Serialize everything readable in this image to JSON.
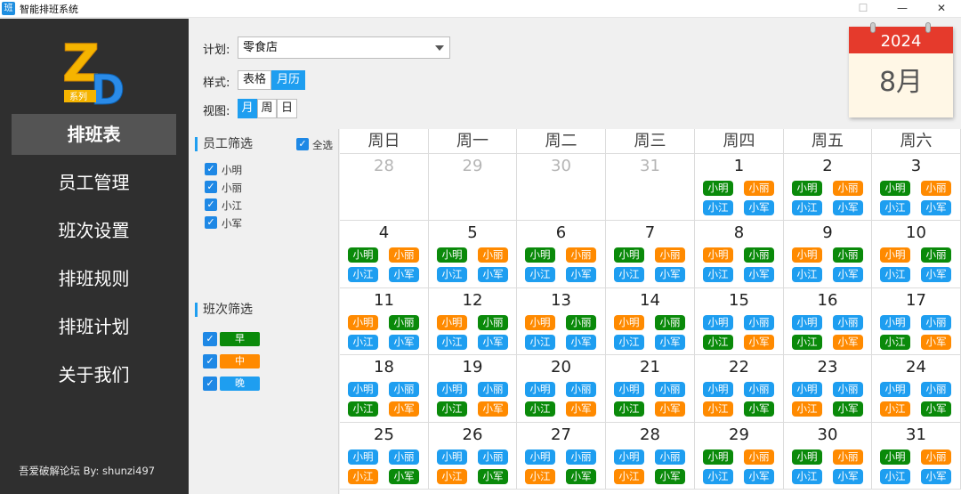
{
  "window": {
    "title": "智能排班系统",
    "icon_text": "班",
    "min": "—",
    "max": "☐",
    "close": "✕"
  },
  "sidebar": {
    "logo_text": "ZD",
    "logo_sub": "系列",
    "items": [
      {
        "label": "排班表",
        "active": true
      },
      {
        "label": "员工管理"
      },
      {
        "label": "班次设置"
      },
      {
        "label": "排班规则"
      },
      {
        "label": "排班计划"
      },
      {
        "label": "关于我们"
      }
    ],
    "footer": "吾爱破解论坛 By: shunzi497"
  },
  "controls": {
    "plan_label": "计划:",
    "plan_value": "零食店",
    "style_label": "样式:",
    "style_options": [
      "表格",
      "月历"
    ],
    "style_selected": "月历",
    "view_label": "视图:",
    "view_options": [
      "月",
      "周",
      "日"
    ],
    "view_selected": "月"
  },
  "badge": {
    "year": "2024",
    "month": "8月"
  },
  "filters": {
    "employee_title": "员工筛选",
    "select_all": "全选",
    "employees": [
      "小明",
      "小丽",
      "小江",
      "小军"
    ],
    "shift_title": "班次筛选",
    "shifts": [
      {
        "label": "早",
        "color": "#0a8a0a"
      },
      {
        "label": "中",
        "color": "#ff8a00"
      },
      {
        "label": "晚",
        "color": "#1e9ef0"
      }
    ]
  },
  "calendar": {
    "weekdays": [
      "周日",
      "周一",
      "周二",
      "周三",
      "周四",
      "周五",
      "周六"
    ],
    "colors": {
      "g": "#0a8a0a",
      "o": "#ff8a00",
      "b": "#1e9ef0"
    },
    "weeks": [
      [
        {
          "day": "28",
          "prev": true,
          "chips": []
        },
        {
          "day": "29",
          "prev": true,
          "chips": []
        },
        {
          "day": "30",
          "prev": true,
          "chips": []
        },
        {
          "day": "31",
          "prev": true,
          "chips": []
        },
        {
          "day": "1",
          "chips": [
            [
              "小明",
              "g"
            ],
            [
              "小丽",
              "o"
            ],
            [
              "小江",
              "b"
            ],
            [
              "小军",
              "b"
            ]
          ]
        },
        {
          "day": "2",
          "chips": [
            [
              "小明",
              "g"
            ],
            [
              "小丽",
              "o"
            ],
            [
              "小江",
              "b"
            ],
            [
              "小军",
              "b"
            ]
          ]
        },
        {
          "day": "3",
          "chips": [
            [
              "小明",
              "g"
            ],
            [
              "小丽",
              "o"
            ],
            [
              "小江",
              "b"
            ],
            [
              "小军",
              "b"
            ]
          ]
        }
      ],
      [
        {
          "day": "4",
          "chips": [
            [
              "小明",
              "g"
            ],
            [
              "小丽",
              "o"
            ],
            [
              "小江",
              "b"
            ],
            [
              "小军",
              "b"
            ]
          ]
        },
        {
          "day": "5",
          "chips": [
            [
              "小明",
              "g"
            ],
            [
              "小丽",
              "o"
            ],
            [
              "小江",
              "b"
            ],
            [
              "小军",
              "b"
            ]
          ]
        },
        {
          "day": "6",
          "chips": [
            [
              "小明",
              "g"
            ],
            [
              "小丽",
              "o"
            ],
            [
              "小江",
              "b"
            ],
            [
              "小军",
              "b"
            ]
          ]
        },
        {
          "day": "7",
          "chips": [
            [
              "小明",
              "g"
            ],
            [
              "小丽",
              "o"
            ],
            [
              "小江",
              "b"
            ],
            [
              "小军",
              "b"
            ]
          ]
        },
        {
          "day": "8",
          "chips": [
            [
              "小明",
              "o"
            ],
            [
              "小丽",
              "g"
            ],
            [
              "小江",
              "b"
            ],
            [
              "小军",
              "b"
            ]
          ]
        },
        {
          "day": "9",
          "chips": [
            [
              "小明",
              "o"
            ],
            [
              "小丽",
              "g"
            ],
            [
              "小江",
              "b"
            ],
            [
              "小军",
              "b"
            ]
          ]
        },
        {
          "day": "10",
          "chips": [
            [
              "小明",
              "o"
            ],
            [
              "小丽",
              "g"
            ],
            [
              "小江",
              "b"
            ],
            [
              "小军",
              "b"
            ]
          ]
        }
      ],
      [
        {
          "day": "11",
          "chips": [
            [
              "小明",
              "o"
            ],
            [
              "小丽",
              "g"
            ],
            [
              "小江",
              "b"
            ],
            [
              "小军",
              "b"
            ]
          ]
        },
        {
          "day": "12",
          "chips": [
            [
              "小明",
              "o"
            ],
            [
              "小丽",
              "g"
            ],
            [
              "小江",
              "b"
            ],
            [
              "小军",
              "b"
            ]
          ]
        },
        {
          "day": "13",
          "chips": [
            [
              "小明",
              "o"
            ],
            [
              "小丽",
              "g"
            ],
            [
              "小江",
              "b"
            ],
            [
              "小军",
              "b"
            ]
          ]
        },
        {
          "day": "14",
          "chips": [
            [
              "小明",
              "o"
            ],
            [
              "小丽",
              "g"
            ],
            [
              "小江",
              "b"
            ],
            [
              "小军",
              "b"
            ]
          ]
        },
        {
          "day": "15",
          "chips": [
            [
              "小明",
              "b"
            ],
            [
              "小丽",
              "b"
            ],
            [
              "小江",
              "g"
            ],
            [
              "小军",
              "o"
            ]
          ]
        },
        {
          "day": "16",
          "chips": [
            [
              "小明",
              "b"
            ],
            [
              "小丽",
              "b"
            ],
            [
              "小江",
              "g"
            ],
            [
              "小军",
              "o"
            ]
          ]
        },
        {
          "day": "17",
          "chips": [
            [
              "小明",
              "b"
            ],
            [
              "小丽",
              "b"
            ],
            [
              "小江",
              "g"
            ],
            [
              "小军",
              "o"
            ]
          ]
        }
      ],
      [
        {
          "day": "18",
          "chips": [
            [
              "小明",
              "b"
            ],
            [
              "小丽",
              "b"
            ],
            [
              "小江",
              "g"
            ],
            [
              "小军",
              "o"
            ]
          ]
        },
        {
          "day": "19",
          "chips": [
            [
              "小明",
              "b"
            ],
            [
              "小丽",
              "b"
            ],
            [
              "小江",
              "g"
            ],
            [
              "小军",
              "o"
            ]
          ]
        },
        {
          "day": "20",
          "chips": [
            [
              "小明",
              "b"
            ],
            [
              "小丽",
              "b"
            ],
            [
              "小江",
              "g"
            ],
            [
              "小军",
              "o"
            ]
          ]
        },
        {
          "day": "21",
          "chips": [
            [
              "小明",
              "b"
            ],
            [
              "小丽",
              "b"
            ],
            [
              "小江",
              "g"
            ],
            [
              "小军",
              "o"
            ]
          ]
        },
        {
          "day": "22",
          "chips": [
            [
              "小明",
              "b"
            ],
            [
              "小丽",
              "b"
            ],
            [
              "小江",
              "o"
            ],
            [
              "小军",
              "g"
            ]
          ]
        },
        {
          "day": "23",
          "chips": [
            [
              "小明",
              "b"
            ],
            [
              "小丽",
              "b"
            ],
            [
              "小江",
              "o"
            ],
            [
              "小军",
              "g"
            ]
          ]
        },
        {
          "day": "24",
          "chips": [
            [
              "小明",
              "b"
            ],
            [
              "小丽",
              "b"
            ],
            [
              "小江",
              "o"
            ],
            [
              "小军",
              "g"
            ]
          ]
        }
      ],
      [
        {
          "day": "25",
          "chips": [
            [
              "小明",
              "b"
            ],
            [
              "小丽",
              "b"
            ],
            [
              "小江",
              "o"
            ],
            [
              "小军",
              "g"
            ]
          ]
        },
        {
          "day": "26",
          "chips": [
            [
              "小明",
              "b"
            ],
            [
              "小丽",
              "b"
            ],
            [
              "小江",
              "o"
            ],
            [
              "小军",
              "g"
            ]
          ]
        },
        {
          "day": "27",
          "chips": [
            [
              "小明",
              "b"
            ],
            [
              "小丽",
              "b"
            ],
            [
              "小江",
              "o"
            ],
            [
              "小军",
              "g"
            ]
          ]
        },
        {
          "day": "28",
          "chips": [
            [
              "小明",
              "b"
            ],
            [
              "小丽",
              "b"
            ],
            [
              "小江",
              "o"
            ],
            [
              "小军",
              "g"
            ]
          ]
        },
        {
          "day": "29",
          "chips": [
            [
              "小明",
              "g"
            ],
            [
              "小丽",
              "o"
            ],
            [
              "小江",
              "b"
            ],
            [
              "小军",
              "b"
            ]
          ]
        },
        {
          "day": "30",
          "chips": [
            [
              "小明",
              "g"
            ],
            [
              "小丽",
              "o"
            ],
            [
              "小江",
              "b"
            ],
            [
              "小军",
              "b"
            ]
          ]
        },
        {
          "day": "31",
          "chips": [
            [
              "小明",
              "g"
            ],
            [
              "小丽",
              "o"
            ],
            [
              "小江",
              "b"
            ],
            [
              "小军",
              "b"
            ]
          ]
        }
      ]
    ]
  }
}
